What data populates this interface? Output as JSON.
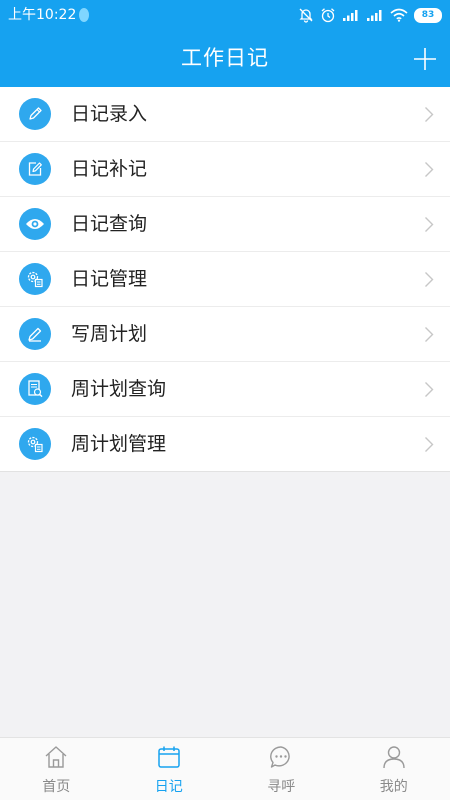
{
  "status_bar": {
    "time": "上午10:22",
    "battery": "83"
  },
  "header": {
    "title": "工作日记",
    "add_icon": "plus-icon"
  },
  "menu": {
    "items": [
      {
        "label": "日记录入",
        "icon": "pencil-icon"
      },
      {
        "label": "日记补记",
        "icon": "edit-square-icon"
      },
      {
        "label": "日记查询",
        "icon": "eye-icon"
      },
      {
        "label": "日记管理",
        "icon": "gear-document-icon"
      },
      {
        "label": "写周计划",
        "icon": "pencil-square-icon"
      },
      {
        "label": "周计划查询",
        "icon": "document-search-icon"
      },
      {
        "label": "周计划管理",
        "icon": "gear-document-icon"
      }
    ]
  },
  "tabs": {
    "active": "日记",
    "items": [
      {
        "label": "首页",
        "icon": "home-icon"
      },
      {
        "label": "日记",
        "icon": "calendar-icon"
      },
      {
        "label": "寻呼",
        "icon": "chat-icon"
      },
      {
        "label": "我的",
        "icon": "user-icon"
      }
    ]
  },
  "colors": {
    "primary": "#16a2f0",
    "icon_bg": "#2fa8ee",
    "tab_inactive": "#8a8a8a"
  }
}
